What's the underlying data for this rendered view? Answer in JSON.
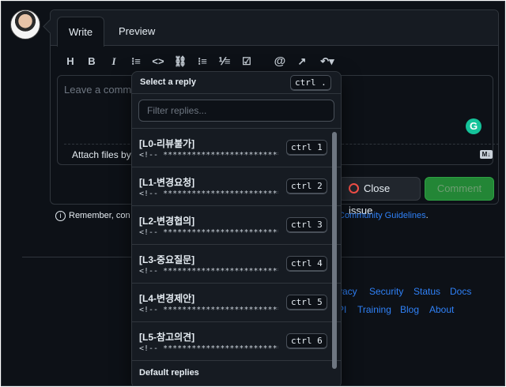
{
  "editor": {
    "tab_write": "Write",
    "tab_preview": "Preview",
    "placeholder": "Leave a comment",
    "attach": "Attach files by d",
    "md_badge": "M↓"
  },
  "toolbar": {
    "heading": "H",
    "bold": "B",
    "italic": "I",
    "quote": "⁝≡",
    "code": "<>",
    "link": "⛓",
    "bullet_list": "⁝≡",
    "numbered_list": "⅟≡",
    "task_list": "☑",
    "mention": "@",
    "reference": "↗",
    "saved_replies": "↶▾"
  },
  "buttons": {
    "close_issue": "Close issue",
    "comment": "Comment"
  },
  "remember": {
    "text": "Remember, con",
    "link": "Community Guidelines",
    "suffix": "."
  },
  "footer": {
    "row1": [
      "vacy",
      "Security",
      "Status",
      "Docs"
    ],
    "row2": [
      "PI",
      "Training",
      "Blog",
      "About"
    ]
  },
  "popup": {
    "title": "Select a reply",
    "shortcut": "ctrl .",
    "filter_placeholder": "Filter replies...",
    "replies": [
      {
        "title": "[L0-리뷰불가]",
        "body": "<!-- ******************************...",
        "shortcut": "ctrl 1"
      },
      {
        "title": "[L1-변경요청]",
        "body": "<!-- ******************************...",
        "shortcut": "ctrl 2"
      },
      {
        "title": "[L2-변경협의]",
        "body": "<!-- ******************************...",
        "shortcut": "ctrl 3"
      },
      {
        "title": "[L3-중요질문]",
        "body": "<!-- ******************************...",
        "shortcut": "ctrl 4"
      },
      {
        "title": "[L4-변경제안]",
        "body": "<!-- ******************************...",
        "shortcut": "ctrl 5"
      },
      {
        "title": "[L5-참고의견]",
        "body": "<!-- ******************************...",
        "shortcut": "ctrl 6"
      }
    ],
    "default_replies": "Default replies"
  }
}
